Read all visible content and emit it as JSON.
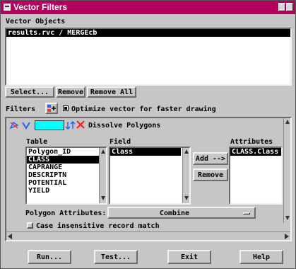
{
  "window": {
    "title": "Vector Filters"
  },
  "vector_objects": {
    "label": "Vector Objects",
    "items": [
      "results.rvc / MERGEcb"
    ],
    "selected_index": 0
  },
  "object_buttons": {
    "select": "Select...",
    "remove": "Remove",
    "remove_all": "Remove All"
  },
  "filters": {
    "label": "Filters",
    "optimize_label": "Optimize vector for faster drawing",
    "optimize_checked": true
  },
  "filter_panel": {
    "title": "Dissolve Polygons",
    "columns": {
      "table": "Table",
      "field": "Field",
      "attributes": "Attributes"
    },
    "table_items": [
      "Polygon_ID",
      "CLASS",
      "CAPRANGE",
      "DESCRIPTN",
      "POTENTIAL",
      "YIELD"
    ],
    "table_selected": 1,
    "field_items": [
      "Class"
    ],
    "field_selected": 0,
    "attribute_items": [
      "CLASS.Class"
    ],
    "attribute_selected": 0,
    "add_label": "Add -->",
    "remove_label": "Remove",
    "polygon_attributes_label": "Polygon Attributes:",
    "polygon_attributes_value": "Combine",
    "case_insensitive_label": "Case insensitive record match",
    "case_insensitive_checked": false
  },
  "bottom_buttons": {
    "run": "Run...",
    "test": "Test...",
    "exit": "Exit",
    "help": "Help"
  },
  "colors": {
    "titlebar": "#b3005f",
    "face": "#c6c6c6",
    "swatch": "#00ffff"
  }
}
